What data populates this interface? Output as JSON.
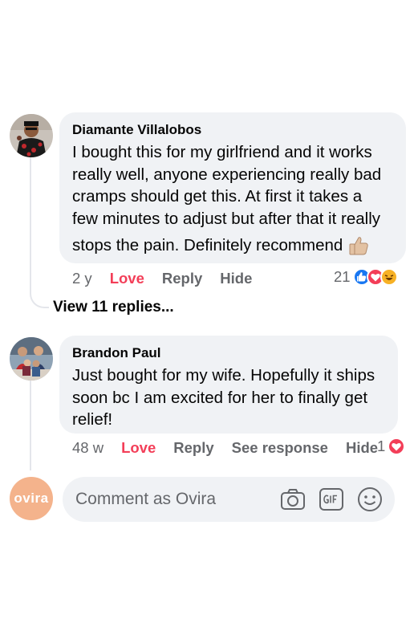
{
  "comments": [
    {
      "author": "Diamante Villalobos",
      "lines": [
        "I bought this for my girlfriend and it works",
        "really well, anyone experiencing really bad",
        "cramps should get this. At first it takes a",
        "few minutes to adjust but after that it really",
        "stops the pain. Definitely recommend"
      ],
      "emoji_icon": "thumbs-up-icon",
      "time": "2 y",
      "love_label": "Love",
      "reply_label": "Reply",
      "hide_label": "Hide",
      "reaction_count": "21",
      "reaction_icons": [
        "like-icon",
        "love-icon",
        "haha-icon"
      ]
    },
    {
      "author": "Brandon Paul",
      "lines": [
        "Just bought for my wife. Hopefully it ships",
        "soon bc I am excited for her to finally get",
        "relief!"
      ],
      "time": "48 w",
      "love_label": "Love",
      "reply_label": "Reply",
      "see_response_label": "See response",
      "hide_label": "Hide",
      "reaction_count": "1",
      "reaction_icons": [
        "love-icon"
      ]
    }
  ],
  "view_replies_label": "View 11 replies...",
  "composer": {
    "brand_logo_text": "ovira",
    "placeholder": "Comment as Ovira",
    "tools": [
      "camera-icon",
      "gif-icon",
      "smiley-icon"
    ]
  },
  "colors": {
    "bubble": "#f0f2f5",
    "love": "#f33e58",
    "secondary_text": "#65676b",
    "brand": "#f4b38c",
    "like_blue": "#1877f2"
  }
}
